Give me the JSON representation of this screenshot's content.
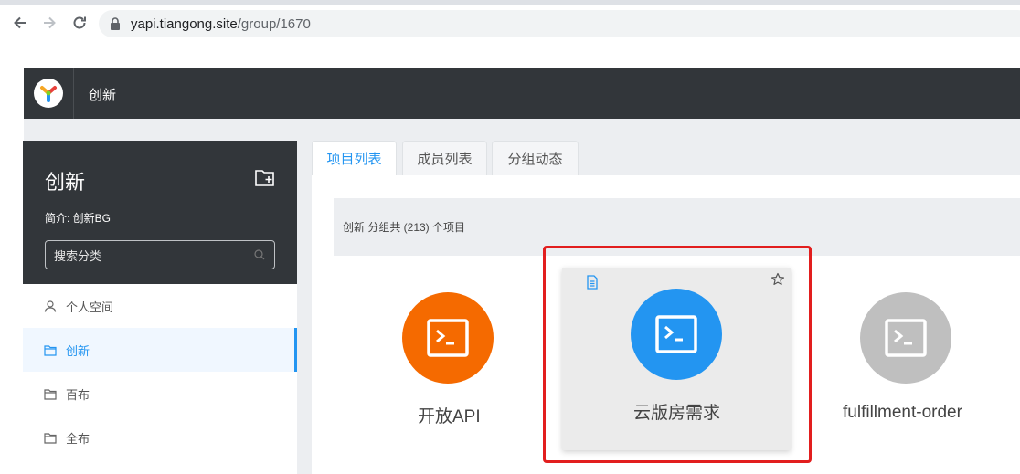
{
  "browser": {
    "url_host": "yapi.tiangong.site",
    "url_path": "/group/1670"
  },
  "header": {
    "title": "创新"
  },
  "sidebar": {
    "group_name": "创新",
    "description": "简介: 创新BG",
    "search_placeholder": "搜索分类",
    "items": [
      {
        "label": "个人空间",
        "icon": "user-icon"
      },
      {
        "label": "创新",
        "icon": "folder-icon",
        "active": true
      },
      {
        "label": "百布",
        "icon": "folder-icon"
      },
      {
        "label": "全布",
        "icon": "folder-icon"
      }
    ]
  },
  "tabs": [
    {
      "label": "项目列表",
      "active": true
    },
    {
      "label": "成员列表"
    },
    {
      "label": "分组动态"
    }
  ],
  "summary": "创新 分组共 (213) 个项目",
  "projects": [
    {
      "name": "开放API",
      "color": "#f56a00"
    },
    {
      "name": "云版房需求",
      "color": "#2395f1"
    },
    {
      "name": "fulfillment-order",
      "color": "#bfbfbf"
    }
  ],
  "colors": {
    "accent": "#2395f1",
    "header_bg": "#32363a",
    "highlight_frame": "#e21e1e"
  }
}
